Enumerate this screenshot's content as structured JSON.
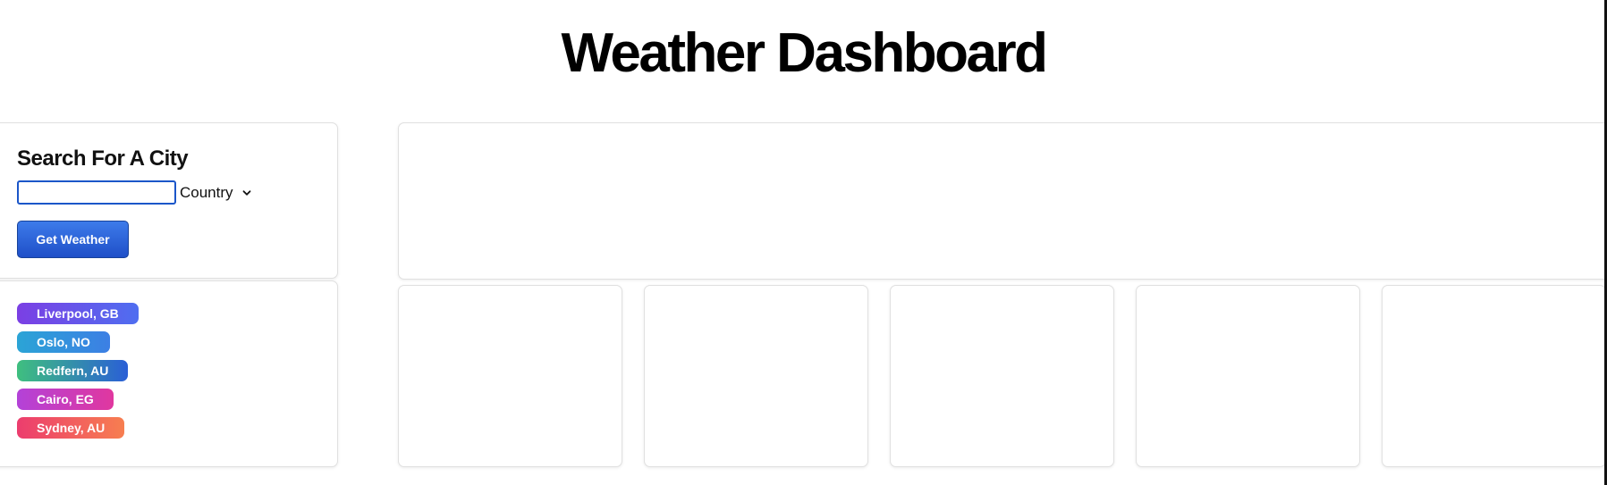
{
  "header": {
    "title": "Weather Dashboard"
  },
  "search": {
    "heading": "Search For A City",
    "input_value": "",
    "input_placeholder": "",
    "country_select_label": "Country",
    "submit_label": "Get Weather"
  },
  "history": {
    "items": [
      {
        "label": "Liverpool, GB",
        "gradient": [
          "#7b3fe4",
          "#4f6ef0"
        ]
      },
      {
        "label": "Oslo, NO",
        "gradient": [
          "#2ba4d6",
          "#3c7fe4"
        ]
      },
      {
        "label": "Redfern, AU",
        "gradient": [
          "#3fbf7f",
          "#2a5fd6"
        ]
      },
      {
        "label": "Cairo, EG",
        "gradient": [
          "#b342d8",
          "#e0379f"
        ]
      },
      {
        "label": "Sydney, AU",
        "gradient": [
          "#ec3d6e",
          "#f77e50"
        ]
      }
    ]
  },
  "colors": {
    "primary_button": "#2a5fd8",
    "input_focus_border": "#1b56c9",
    "card_border": "#e0e0e0"
  }
}
